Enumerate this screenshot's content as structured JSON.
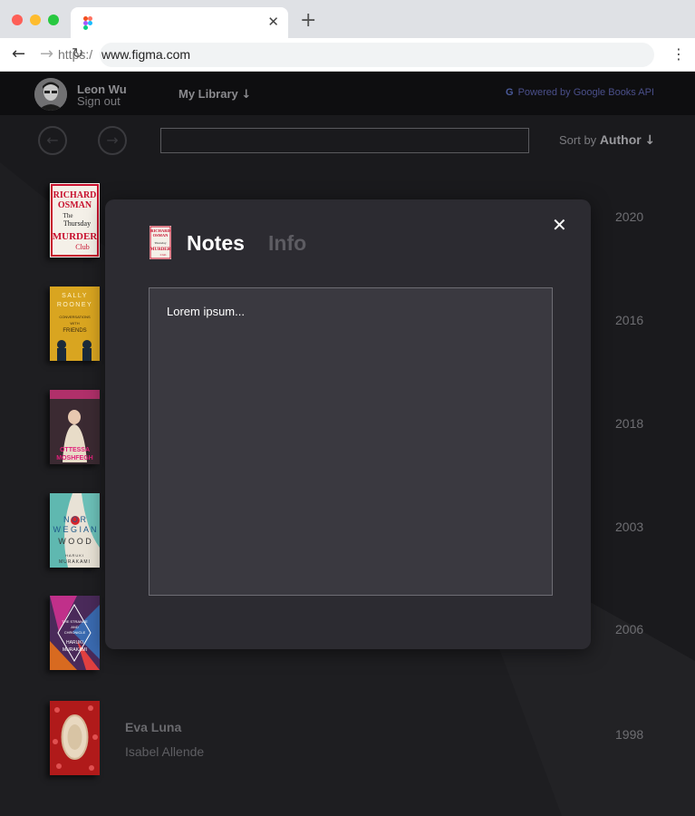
{
  "browser": {
    "new_tab_label": "+",
    "tab_close_label": "✕",
    "url_prefix": "https:/",
    "url": "www.figma.com"
  },
  "app": {
    "user_name": "Leon Wu",
    "sign_out_label": "Sign out",
    "library_label": "My Library",
    "powered_by": "Powered by Google Books API",
    "search_value": "",
    "sort_prefix": "Sort by",
    "sort_field": "Author",
    "books": [
      {
        "title": "The Thursday Murder Club",
        "author": "Richard Osman",
        "year": "2020",
        "cover_lines": [
          "RICHARD",
          "OSMAN",
          "The",
          "Thursday",
          "MURDER",
          "Club"
        ]
      },
      {
        "title": "Conversations with Friends",
        "author": "Sally Rooney",
        "year": "2016",
        "cover_lines": [
          "SALLY",
          "ROONEY",
          "CONVERSATIONS",
          "WITH",
          "FRIENDS"
        ]
      },
      {
        "title": "",
        "author": "Ottessa Moshfegh",
        "year": "2018",
        "cover_lines": [
          "OTTESSA",
          "MOSHFEGH"
        ]
      },
      {
        "title": "Norwegian Wood",
        "author": "Haruki Murakami",
        "year": "2003",
        "cover_lines": [
          "N O R",
          "W E G I A N",
          "W O O D",
          "HARUKI",
          "MURAKAMI"
        ]
      },
      {
        "title": "",
        "author": "Haruki Murakami",
        "year": "2006",
        "cover_lines": [
          "THE STRANGE",
          "AND",
          "CHRONICLE",
          "HARUKI",
          "MURAKAMI"
        ]
      },
      {
        "title": "Eva Luna",
        "author": "Isabel Allende",
        "year": "1998",
        "cover_lines": []
      }
    ]
  },
  "modal": {
    "tab_notes": "Notes",
    "tab_info": "Info",
    "close_label": "✕",
    "notes_text": "Lorem ipsum..."
  },
  "colors": {
    "app_background": "#1a1a1d",
    "modal_background": "#2c2b31",
    "textarea_background": "#3a3940",
    "active_tab": "#ffffff",
    "inactive_tab": "#5d5c62"
  }
}
